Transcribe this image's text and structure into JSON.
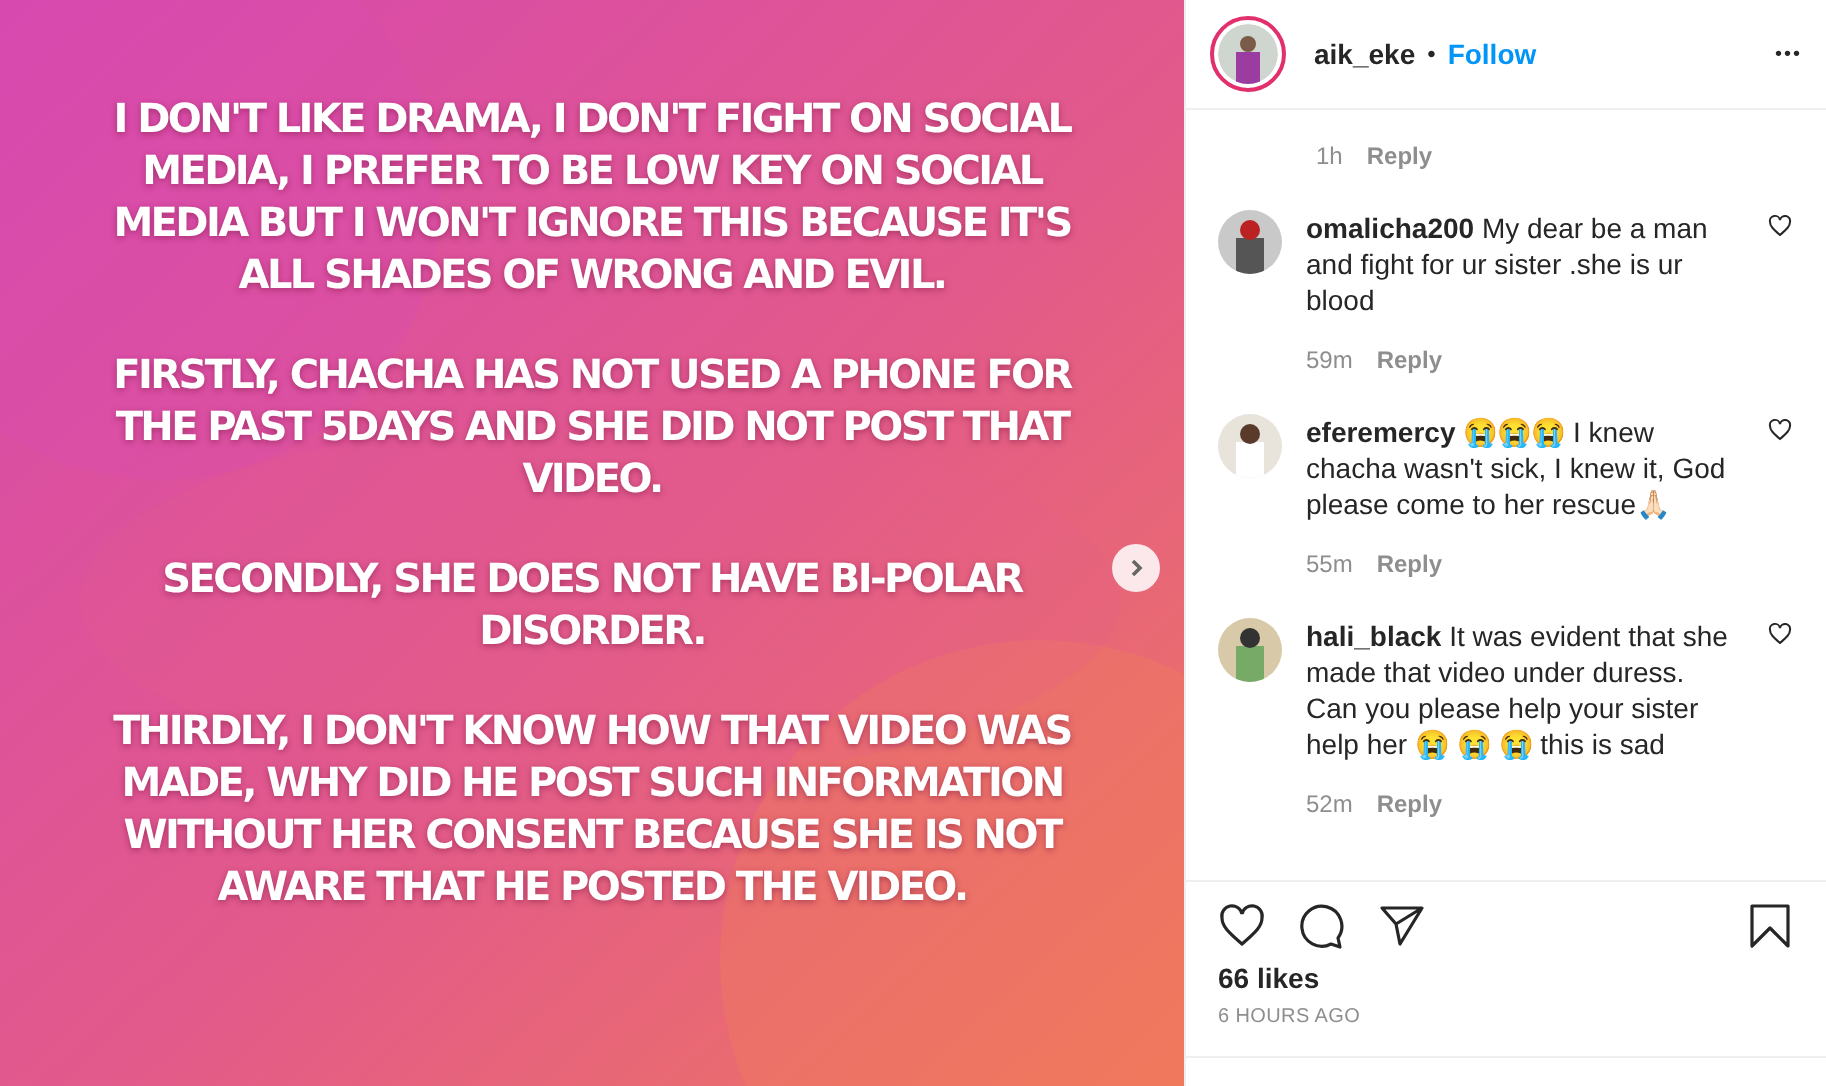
{
  "post_image": {
    "paragraphs": [
      "I DON'T LIKE DRAMA, I DON'T FIGHT ON SOCIAL MEDIA, I PREFER TO BE LOW KEY ON SOCIAL MEDIA BUT I WON'T IGNORE THIS BECAUSE IT'S ALL SHADES OF WRONG AND EVIL.",
      "FIRSTLY, CHACHA HAS NOT USED A PHONE FOR THE PAST 5DAYS AND SHE DID NOT POST THAT VIDEO.",
      "SECONDLY, SHE DOES NOT HAVE BI-POLAR DISORDER.",
      "THIRDLY, I DON'T KNOW HOW THAT VIDEO WAS MADE, WHY DID HE POST SUCH INFORMATION WITHOUT HER CONSENT BECAUSE SHE IS NOT AWARE THAT HE POSTED THE VIDEO."
    ]
  },
  "header": {
    "username": "aik_eke",
    "separator": "•",
    "follow": "Follow",
    "more": "•••"
  },
  "first_comment_meta": {
    "time": "1h",
    "reply": "Reply"
  },
  "comments": [
    {
      "username": "omalicha200",
      "text": "My dear be a man and fight for ur sister .she is ur blood",
      "time": "59m",
      "reply": "Reply"
    },
    {
      "username": "eferemercy",
      "text": "😭😭😭 I knew chacha wasn't sick, I knew it, God please come to her rescue🙏🏻",
      "time": "55m",
      "reply": "Reply"
    },
    {
      "username": "hali_black",
      "text": "It was evident that she made that video under duress. Can you please help your sister help her 😭 😭 😭 this is sad",
      "time": "52m",
      "reply": "Reply"
    }
  ],
  "likes": "66 likes",
  "posted": "6 HOURS AGO"
}
